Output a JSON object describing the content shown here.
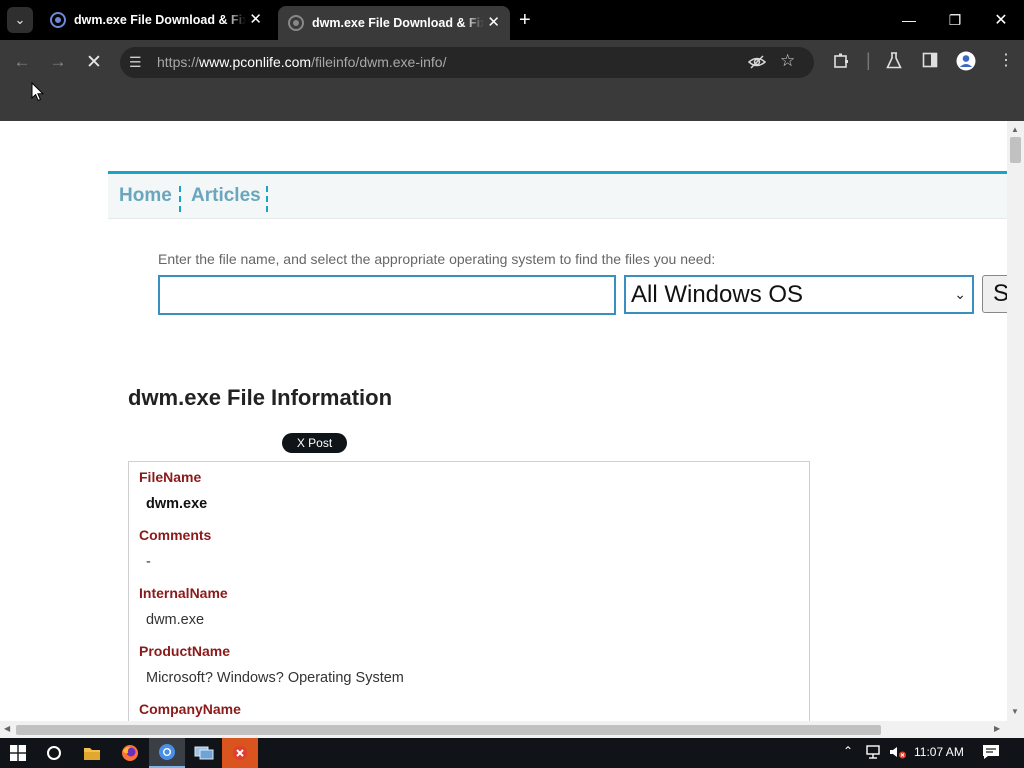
{
  "browser": {
    "tabs": [
      {
        "title": "dwm.exe File Download & Fix | ",
        "active": false
      },
      {
        "title": "dwm.exe File Download & Fix | ",
        "active": true
      }
    ],
    "url_scheme": "https://",
    "url_host": "www.pconlife.com",
    "url_path": "/fileinfo/dwm.exe-info/"
  },
  "nav": {
    "home": "Home",
    "articles": "Articles"
  },
  "search": {
    "label": "Enter the file name, and select the appropriate operating system to find the files you need:",
    "input_value": "",
    "os_selected": "All Windows OS",
    "button_label": "S"
  },
  "page_title": "dwm.exe File Information",
  "share": {
    "x_post_label": "X Post"
  },
  "info_rows": [
    {
      "key": "FileName",
      "value": "dwm.exe"
    },
    {
      "key": "Comments",
      "value": "-"
    },
    {
      "key": "InternalName",
      "value": "dwm.exe"
    },
    {
      "key": "ProductName",
      "value": "Microsoft? Windows? Operating System"
    },
    {
      "key": "CompanyName",
      "value": ""
    }
  ],
  "taskbar": {
    "clock": "11:07 AM"
  },
  "colors": {
    "accent": "#1aa3c8",
    "nav_link": "#6aa6bc",
    "info_key": "#8b1a1a",
    "input_border": "#3a8ec0"
  }
}
